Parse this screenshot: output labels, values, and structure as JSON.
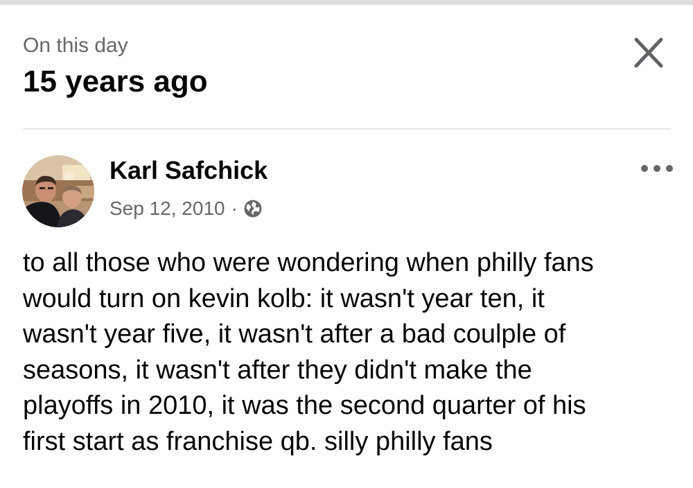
{
  "memory": {
    "kicker": "On this day",
    "title": "15 years ago"
  },
  "icons": {
    "close": "close-icon",
    "more": "more-options-icon",
    "audience": "globe-icon",
    "avatar": "profile-photo"
  },
  "post": {
    "author": "Karl Safchick",
    "date": "Sep 12, 2010",
    "separator": "·",
    "lines": [
      "to all those who were wondering when philly fans",
      "would turn on kevin kolb: it wasn't year ten, it",
      "wasn't year five, it wasn't after a bad coulple of",
      "seasons, it wasn't after they didn't make the",
      "playoffs in 2010, it was the second quarter of his",
      "first start as franchise qb. silly philly fans"
    ]
  },
  "colors": {
    "primary_text": "#050505",
    "secondary_text": "#65676b",
    "divider": "#e4e6eb",
    "top_strip": "#dddfe2"
  }
}
